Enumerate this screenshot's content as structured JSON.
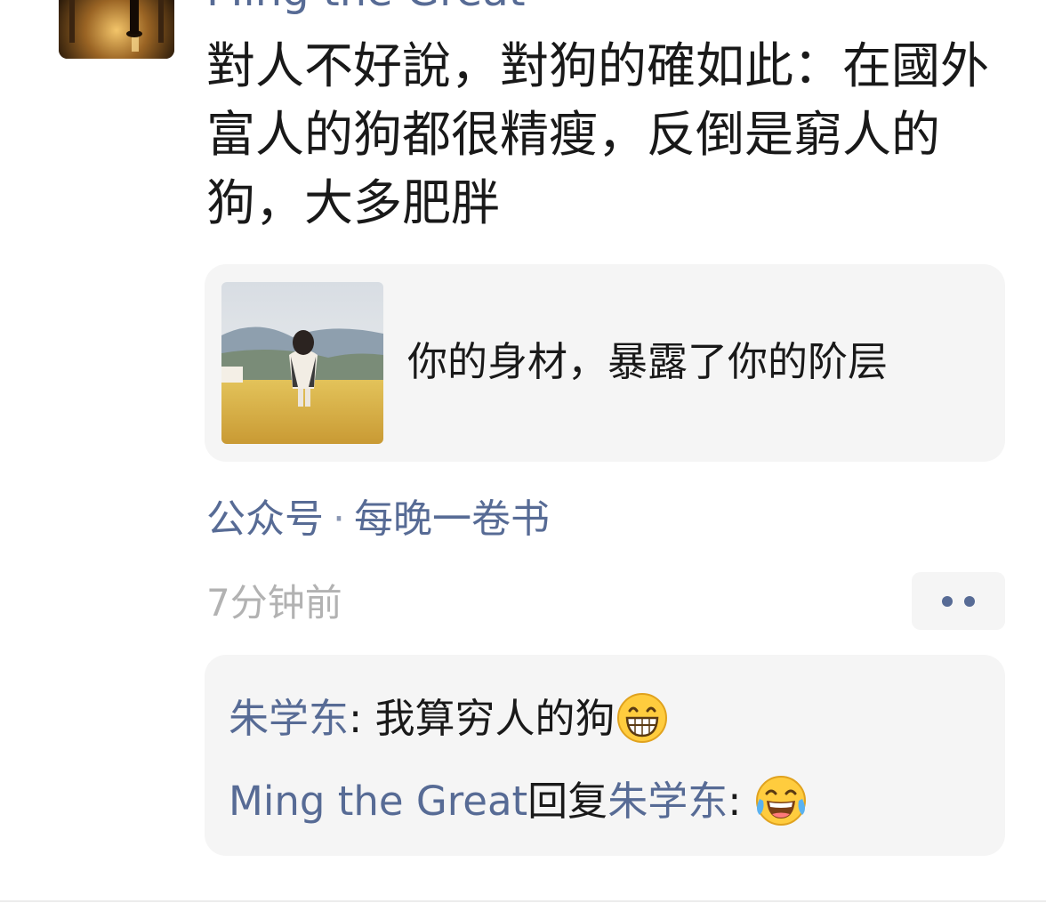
{
  "post": {
    "author": "Ming the Great",
    "text": "對人不好說，對狗的確如此：在國外富人的狗都很精瘦，反倒是窮人的狗，大多肥胖",
    "link": {
      "title": "你的身材，暴露了你的阶层"
    },
    "source": {
      "label": "公众号",
      "separator": "·",
      "name": "每晚一卷书"
    },
    "time": "7分钟前"
  },
  "comments": [
    {
      "name": "朱学东",
      "colon": ": ",
      "text": "我算穷人的狗",
      "emoji": "grinning-face-icon"
    },
    {
      "name": "Ming the Great",
      "reply_word": "回复",
      "reply_to": "朱学东",
      "colon": ": ",
      "emoji": "tears-of-joy-icon"
    }
  ],
  "colors": {
    "name_blue": "#576b95",
    "body_text": "#191919",
    "muted": "#b2b2b2",
    "card_bg": "#f5f5f5"
  }
}
